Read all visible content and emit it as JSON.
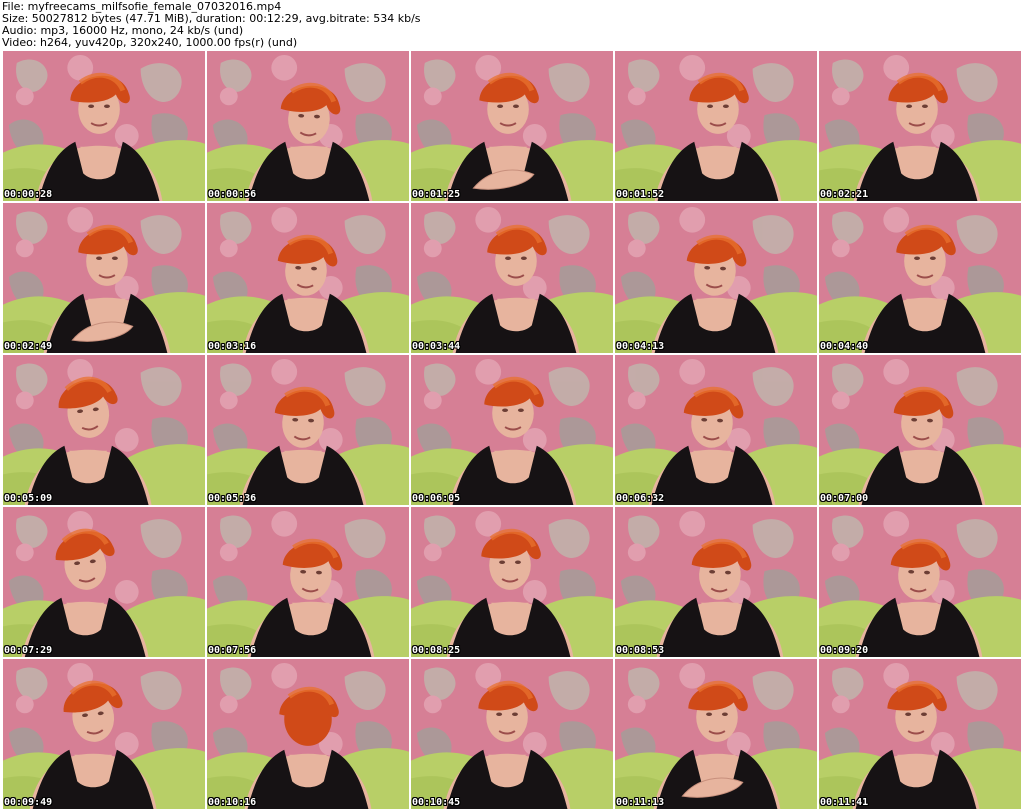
{
  "header": {
    "file": "File: myfreecams_milfsofie_female_07032016.mp4",
    "size": "Size: 50027812 bytes (47.71 MiB), duration: 00:12:29, avg.bitrate: 534 kb/s",
    "audio": "Audio: mp3, 16000 Hz, mono, 24 kb/s (und)",
    "video": "Video: h264, yuv420p, 320x240, 1000.00 fps(r) (und)"
  },
  "colors": {
    "wallpaper": "#d67f95",
    "wallpaper_light": "#e8b2be",
    "leaf": "#b9c8b5",
    "leaf_dark": "#93a89a",
    "sofa": "#b8cf67",
    "sofa_dark": "#9bb64c",
    "hair": "#d04a18",
    "hair_light": "#e8722d",
    "skin": "#e7b49e",
    "dress": "#161214"
  },
  "thumbnails": [
    {
      "time": "00:00:28",
      "pose": "center",
      "icon": "video-frame"
    },
    {
      "time": "00:00:56",
      "pose": "down",
      "icon": "video-frame"
    },
    {
      "time": "00:01:25",
      "pose": "hand",
      "icon": "video-frame"
    },
    {
      "time": "00:01:52",
      "pose": "center",
      "icon": "video-frame"
    },
    {
      "time": "00:02:21",
      "pose": "center",
      "icon": "video-frame"
    },
    {
      "time": "00:02:49",
      "pose": "hand",
      "icon": "video-frame"
    },
    {
      "time": "00:03:16",
      "pose": "down",
      "icon": "video-frame"
    },
    {
      "time": "00:03:44",
      "pose": "center",
      "icon": "video-frame"
    },
    {
      "time": "00:04:13",
      "pose": "down",
      "icon": "video-frame"
    },
    {
      "time": "00:04:40",
      "pose": "center",
      "icon": "video-frame"
    },
    {
      "time": "00:05:09",
      "pose": "left",
      "icon": "video-frame"
    },
    {
      "time": "00:05:36",
      "pose": "down",
      "icon": "video-frame"
    },
    {
      "time": "00:06:05",
      "pose": "center",
      "icon": "video-frame"
    },
    {
      "time": "00:06:32",
      "pose": "down",
      "icon": "video-frame"
    },
    {
      "time": "00:07:00",
      "pose": "down",
      "icon": "video-frame"
    },
    {
      "time": "00:07:29",
      "pose": "left",
      "icon": "video-frame"
    },
    {
      "time": "00:07:56",
      "pose": "down",
      "icon": "video-frame"
    },
    {
      "time": "00:08:25",
      "pose": "center",
      "icon": "video-frame"
    },
    {
      "time": "00:08:53",
      "pose": "down",
      "icon": "video-frame"
    },
    {
      "time": "00:09:20",
      "pose": "down",
      "icon": "video-frame"
    },
    {
      "time": "00:09:49",
      "pose": "left",
      "icon": "video-frame"
    },
    {
      "time": "00:10:16",
      "pose": "back",
      "icon": "video-frame"
    },
    {
      "time": "00:10:45",
      "pose": "center",
      "icon": "video-frame"
    },
    {
      "time": "00:11:13",
      "pose": "hand",
      "icon": "video-frame"
    },
    {
      "time": "00:11:41",
      "pose": "center",
      "icon": "video-frame"
    }
  ]
}
